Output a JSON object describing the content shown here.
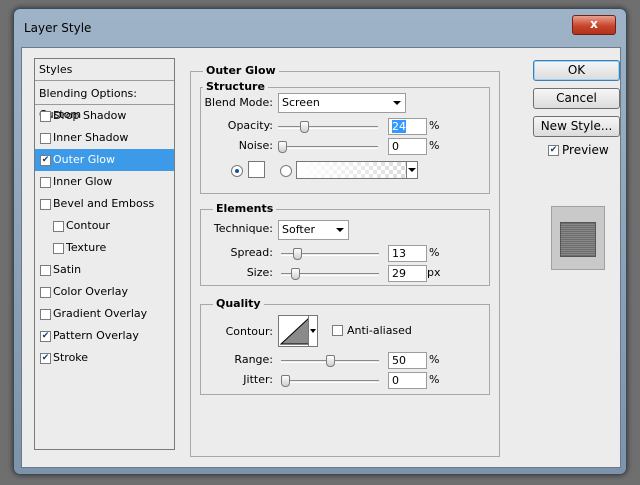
{
  "window": {
    "title": "Layer Style",
    "close_glyph": "x"
  },
  "styles_list": {
    "header": "Styles",
    "blending": "Blending Options: Custom",
    "items": [
      {
        "label": "Drop Shadow",
        "checked": false,
        "sub": false,
        "selected": false
      },
      {
        "label": "Inner Shadow",
        "checked": false,
        "sub": false,
        "selected": false
      },
      {
        "label": "Outer Glow",
        "checked": true,
        "sub": false,
        "selected": true
      },
      {
        "label": "Inner Glow",
        "checked": false,
        "sub": false,
        "selected": false
      },
      {
        "label": "Bevel and Emboss",
        "checked": false,
        "sub": false,
        "selected": false
      },
      {
        "label": "Contour",
        "checked": false,
        "sub": true,
        "selected": false
      },
      {
        "label": "Texture",
        "checked": false,
        "sub": true,
        "selected": false
      },
      {
        "label": "Satin",
        "checked": false,
        "sub": false,
        "selected": false
      },
      {
        "label": "Color Overlay",
        "checked": false,
        "sub": false,
        "selected": false
      },
      {
        "label": "Gradient Overlay",
        "checked": false,
        "sub": false,
        "selected": false
      },
      {
        "label": "Pattern Overlay",
        "checked": true,
        "sub": false,
        "selected": false
      },
      {
        "label": "Stroke",
        "checked": true,
        "sub": false,
        "selected": false
      }
    ]
  },
  "outer_glow": {
    "title": "Outer Glow",
    "structure": {
      "title": "Structure",
      "blend_mode_label": "Blend Mode:",
      "blend_mode": "Screen",
      "opacity_label": "Opacity:",
      "opacity": "24",
      "opacity_unit": "%",
      "noise_label": "Noise:",
      "noise": "0",
      "noise_unit": "%",
      "color_mode": "solid",
      "glow_color": "#ffffff"
    },
    "elements": {
      "title": "Elements",
      "technique_label": "Technique:",
      "technique": "Softer",
      "spread_label": "Spread:",
      "spread": "13",
      "spread_unit": "%",
      "size_label": "Size:",
      "size": "29",
      "size_unit": "px"
    },
    "quality": {
      "title": "Quality",
      "contour_label": "Contour:",
      "anti_aliased_label": "Anti-aliased",
      "anti_aliased": false,
      "range_label": "Range:",
      "range": "50",
      "range_unit": "%",
      "jitter_label": "Jitter:",
      "jitter": "0",
      "jitter_unit": "%"
    }
  },
  "buttons": {
    "ok": "OK",
    "cancel": "Cancel",
    "new_style": "New Style..."
  },
  "preview": {
    "label": "Preview",
    "checked": true
  },
  "colors": {
    "selection": "#3d9ae8",
    "dialog_bg": "#ececec"
  }
}
